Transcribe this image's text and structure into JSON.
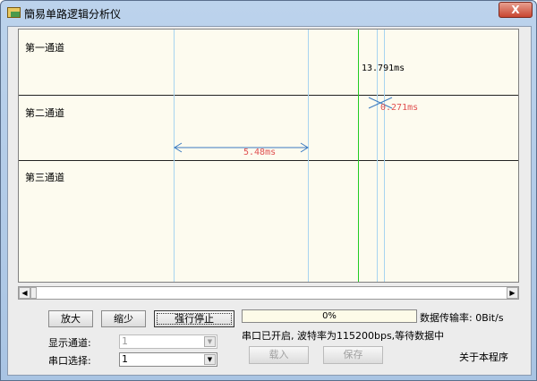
{
  "window": {
    "title": "簡易单路逻辑分析仪",
    "close": "X"
  },
  "plot": {
    "channels": [
      "第一通道",
      "第二通道",
      "第三通道"
    ],
    "measurements": {
      "green_cursor": "13.791ms",
      "blue_cursor_delta": "0.271ms",
      "span": "5.48ms"
    }
  },
  "controls": {
    "zoom_in": "放大",
    "zoom_out": "缩少",
    "force_stop": "强行停止",
    "progress": "0%",
    "progress_value": 0,
    "rate_label": "数据传输率: 0Bit/s",
    "status": "串口已开启, 波特率为115200bps,等待数据中",
    "channel_label": "显示通道:",
    "channel_value": "1",
    "port_label": "串口选择:",
    "port_value": "1",
    "load": "载入",
    "save": "保存",
    "about": "关于本程序"
  },
  "colors": {
    "green_cursor": "#22cc22",
    "measure": "#3a7ac0",
    "red_label": "#e05050"
  }
}
